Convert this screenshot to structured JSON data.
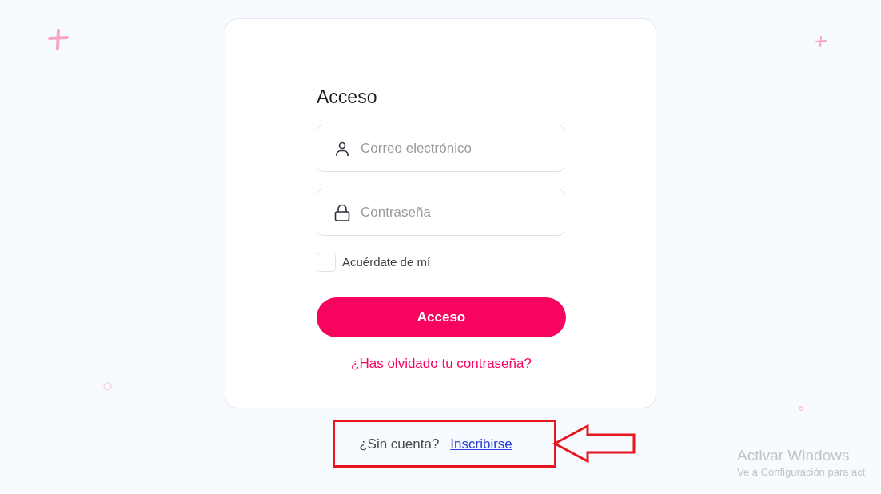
{
  "login_card": {
    "title": "Acceso",
    "fields": [
      {
        "kind": "user",
        "placeholder": "Correo electrónico"
      },
      {
        "kind": "password",
        "placeholder": "Contraseña"
      }
    ],
    "remember": {
      "label": "Acuérdate de mí",
      "checked": false
    },
    "submit_button": "Acceso",
    "forgot_link": "¿Has olvidado tu contraseña?"
  },
  "signup": {
    "prompt": "¿Sin cuenta?",
    "link": "Inscribirse"
  },
  "activation_notice": {
    "title": "Activar Windows",
    "subtitle": "Ve a Configuración para act"
  }
}
